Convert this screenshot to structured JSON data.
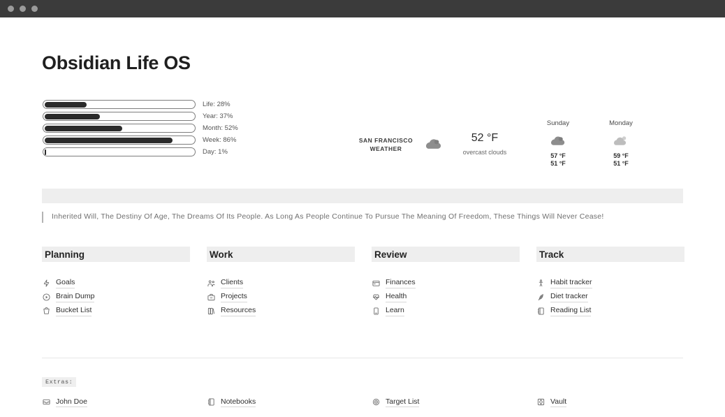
{
  "window": {
    "traffic_lights": [
      "close",
      "minimize",
      "maximize"
    ]
  },
  "header": {
    "title": "Obsidian Life OS"
  },
  "progress": {
    "items": [
      {
        "label": "Life: 28%",
        "name": "Life",
        "percent": 28
      },
      {
        "label": "Year: 37%",
        "name": "Year",
        "percent": 37
      },
      {
        "label": "Month: 52%",
        "name": "Month",
        "percent": 52
      },
      {
        "label": "Week: 86%",
        "name": "Week",
        "percent": 86
      },
      {
        "label": "Day: 1%",
        "name": "Day",
        "percent": 1
      }
    ]
  },
  "weather": {
    "city_line1": "SAN FRANCISCO",
    "city_line2": "WEATHER",
    "icon": "cloud-icon",
    "temperature": "52 °F",
    "description": "overcast clouds",
    "forecast": [
      {
        "day": "Sunday",
        "icon": "cloud-icon",
        "high": "57 °F",
        "low": "51 °F"
      },
      {
        "day": "Monday",
        "icon": "cloud-sun-icon",
        "high": "59 °F",
        "low": "51 °F"
      }
    ]
  },
  "quote": {
    "text": "Inherited Will, The Destiny Of Age, The Dreams Of Its People. As Long As People Continue To Pursue The Meaning Of Freedom, These Things Will Never Cease!"
  },
  "columns": [
    {
      "title": "Planning",
      "items": [
        {
          "label": "Goals",
          "icon": "lightning-bolt-icon"
        },
        {
          "label": "Brain Dump",
          "icon": "circle-play-icon"
        },
        {
          "label": "Bucket List",
          "icon": "bucket-icon"
        }
      ]
    },
    {
      "title": "Work",
      "items": [
        {
          "label": "Clients",
          "icon": "people-icon"
        },
        {
          "label": "Projects",
          "icon": "briefcase-icon"
        },
        {
          "label": "Resources",
          "icon": "books-icon"
        }
      ]
    },
    {
      "title": "Review",
      "items": [
        {
          "label": "Finances",
          "icon": "wallet-icon"
        },
        {
          "label": "Health",
          "icon": "heart-pulse-icon"
        },
        {
          "label": "Learn",
          "icon": "book-icon"
        }
      ]
    },
    {
      "title": "Track",
      "items": [
        {
          "label": "Habit tracker",
          "icon": "person-activity-icon"
        },
        {
          "label": "Diet tracker",
          "icon": "leaf-icon"
        },
        {
          "label": "Reading List",
          "icon": "notebook-icon"
        }
      ]
    }
  ],
  "extras": {
    "tag": "Extras:",
    "items": [
      {
        "label": "John Doe",
        "icon": "inbox-icon"
      },
      {
        "label": "Notebooks",
        "icon": "notebook-icon"
      },
      {
        "label": "Target List",
        "icon": "target-icon"
      },
      {
        "label": "Vault",
        "icon": "vault-icon"
      }
    ]
  },
  "colors": {
    "titlebar": "#3b3b3b",
    "accent_bar": "#2b2b2b",
    "banner": "#eeeeee",
    "text": "#2e2e2e"
  }
}
